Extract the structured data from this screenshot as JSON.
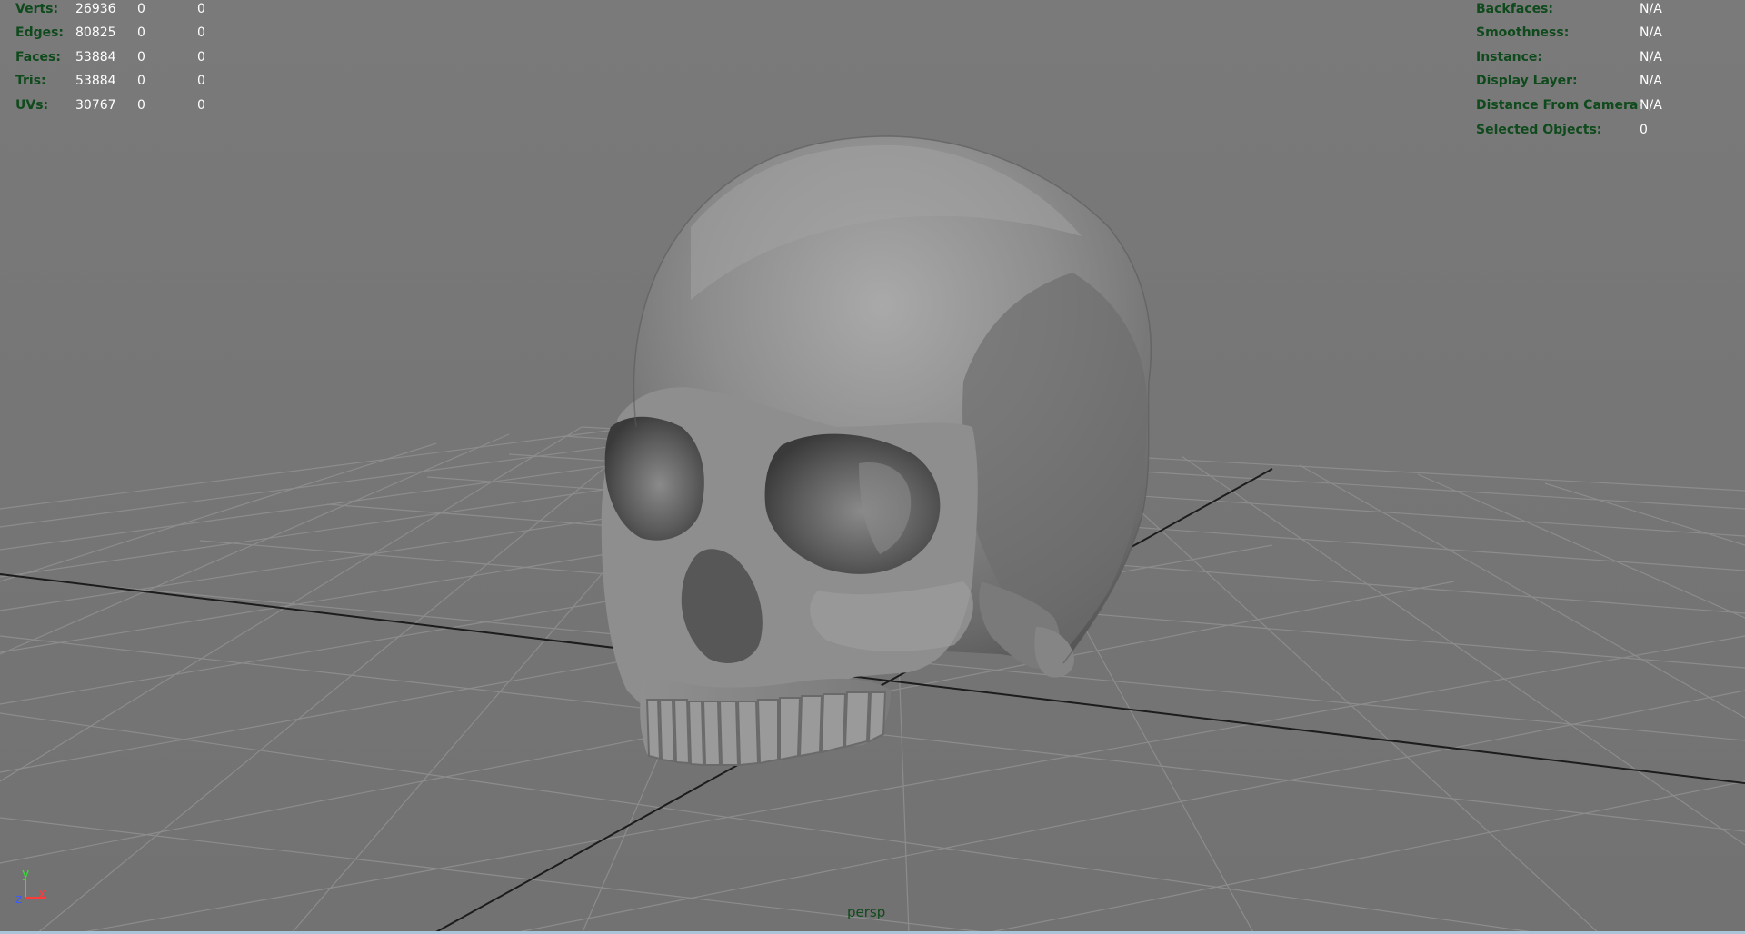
{
  "viewport": {
    "camera_label": "persp",
    "background_color": "#767676",
    "grid_color": "#8a8a8a",
    "axis_line_color": "#1c1c1c",
    "hud_label_color": "#0f4a1c",
    "hud_value_color": "#ffffff"
  },
  "poly_count": {
    "rows": [
      {
        "label": "Verts:",
        "values": [
          "26936",
          "0",
          "0"
        ]
      },
      {
        "label": "Edges:",
        "values": [
          "80825",
          "0",
          "0"
        ]
      },
      {
        "label": "Faces:",
        "values": [
          "53884",
          "0",
          "0"
        ]
      },
      {
        "label": "Tris:",
        "values": [
          "53884",
          "0",
          "0"
        ]
      },
      {
        "label": "UVs:",
        "values": [
          "30767",
          "0",
          "0"
        ]
      }
    ]
  },
  "object_details": {
    "rows": [
      {
        "label": "Backfaces:",
        "value": "N/A"
      },
      {
        "label": "Smoothness:",
        "value": "N/A"
      },
      {
        "label": "Instance:",
        "value": "N/A"
      },
      {
        "label": "Display Layer:",
        "value": "N/A"
      },
      {
        "label": "Distance From Camera:",
        "value": "N/A"
      },
      {
        "label": "Selected Objects:",
        "value": "0"
      }
    ]
  },
  "axis_gizmo": {
    "y_label": "y",
    "z_label": "z",
    "x_label": "x",
    "y_color": "#3adf3a",
    "z_color": "#3a5bff",
    "x_color": "#ff3a3a"
  },
  "model": {
    "icon": "skull-model"
  }
}
